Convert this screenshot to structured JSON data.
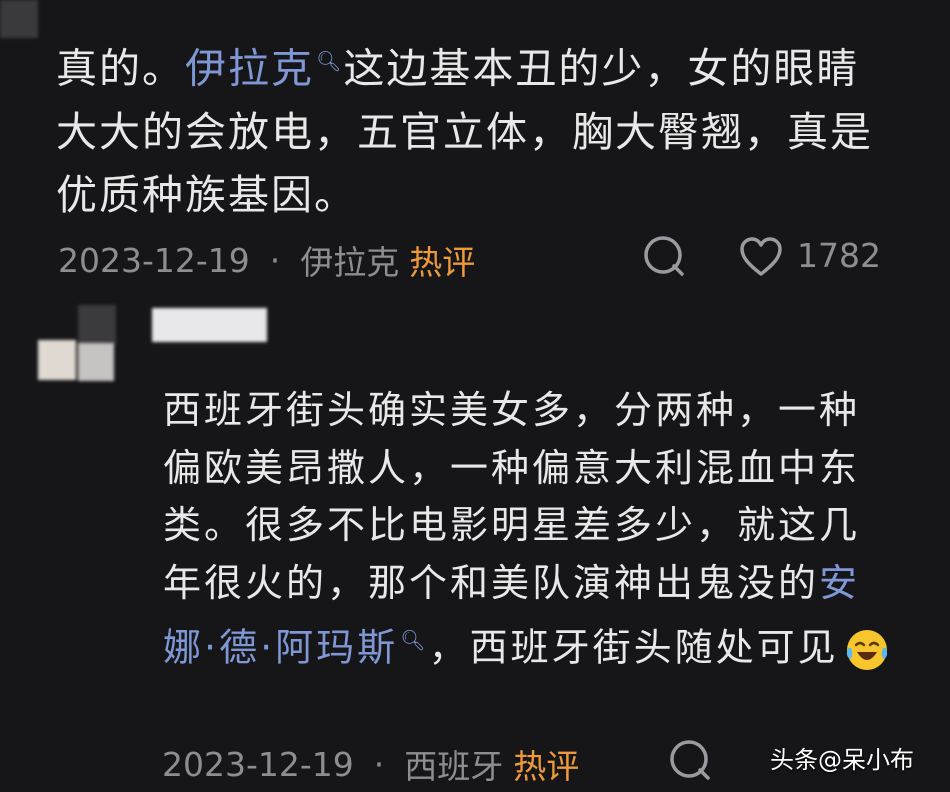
{
  "comment1": {
    "text_before_link": "真的。",
    "link": "伊拉克",
    "text_after_link": "这边基本丑的少，女的眼睛大大的会放电，五官立体，胸大臀翘，真是优质种族基因。",
    "date": "2023-12-19",
    "location": "伊拉克",
    "hot_label": "热评",
    "likes": "1782"
  },
  "comment2": {
    "text_before_link": "西班牙街头确实美女多，分两种，一种偏欧美昂撒人，一种偏意大利混血中东类。很多不比电影明星差多少，就这几年很火的，那个和美队演神出鬼没的",
    "link": "安娜·德·阿玛斯",
    "text_after_link": "，西班牙街头随处可见",
    "date": "2023-12-19",
    "location": "西班牙",
    "hot_label": "热评"
  },
  "icons": [
    "search-icon",
    "comment-icon",
    "heart-icon",
    "cry-laugh-emoji"
  ],
  "watermark": "头条@呆小布",
  "colors": {
    "background": "#161618",
    "link": "#7f97d4",
    "hot": "#ee9a3c",
    "meta": "#8e8e92"
  }
}
